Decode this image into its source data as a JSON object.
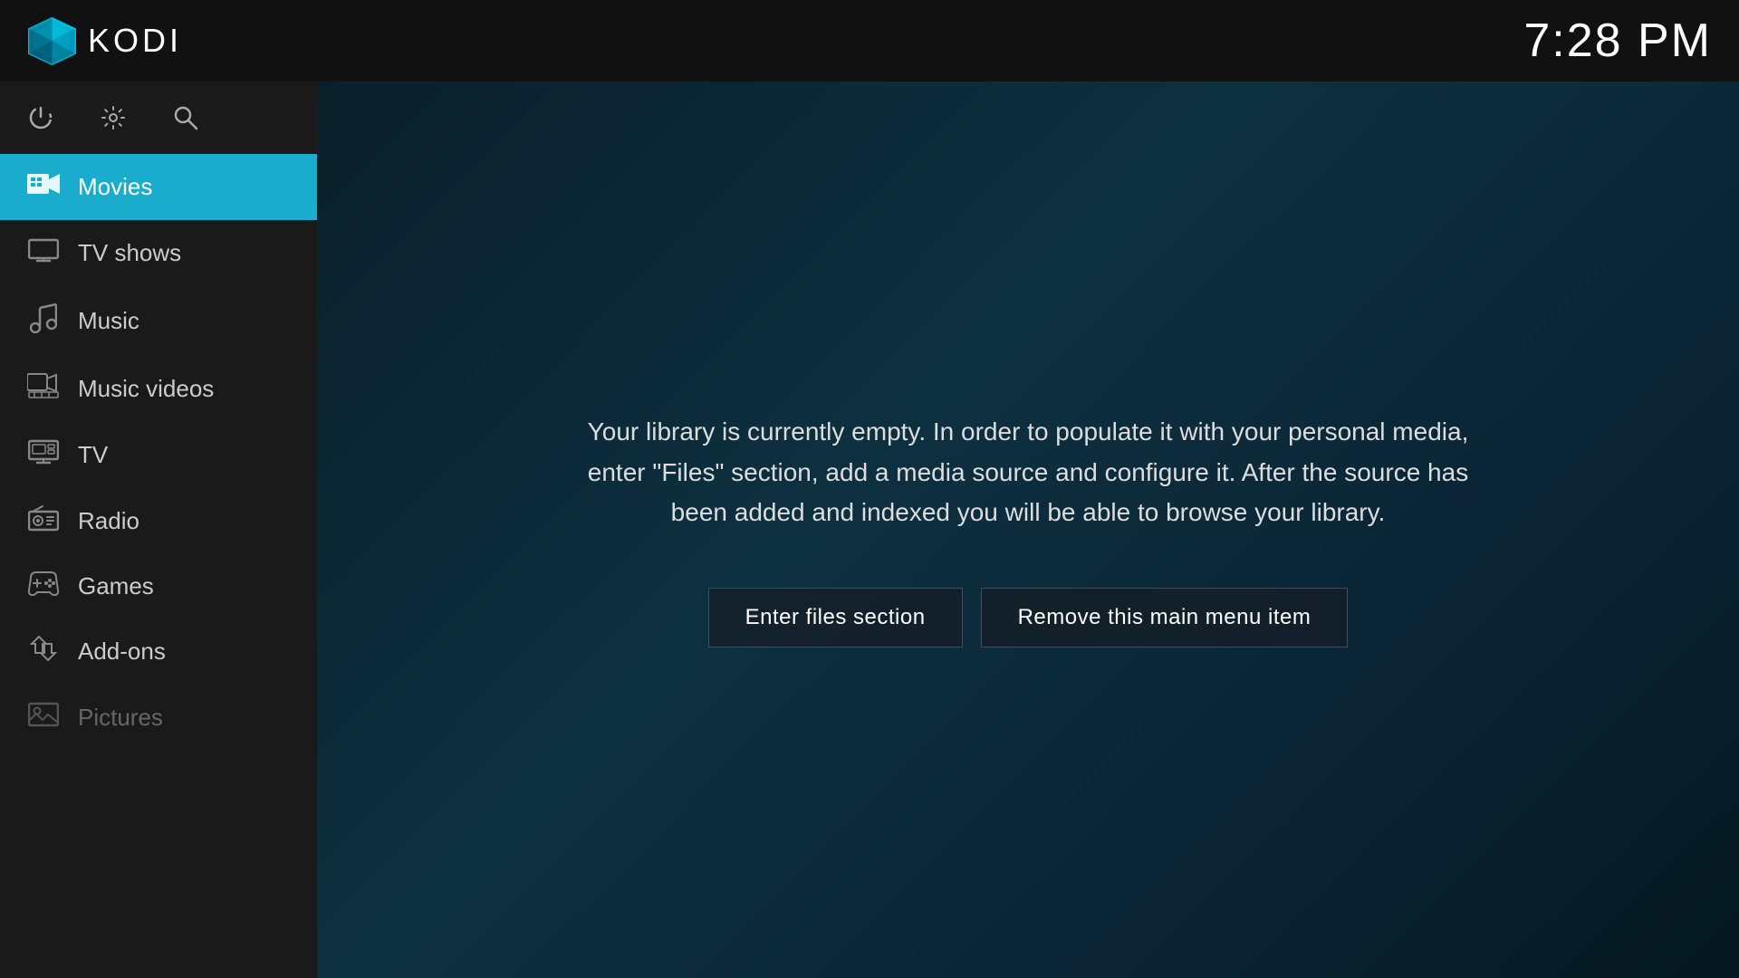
{
  "topbar": {
    "app_name": "KODI",
    "time": "7:28 PM"
  },
  "toolbar": {
    "icons": [
      {
        "name": "power-icon",
        "symbol": "⏻"
      },
      {
        "name": "settings-icon",
        "symbol": "⚙"
      },
      {
        "name": "search-icon",
        "symbol": "🔍"
      }
    ]
  },
  "sidebar": {
    "items": [
      {
        "id": "movies",
        "label": "Movies",
        "icon": "movies-icon",
        "active": true
      },
      {
        "id": "tv-shows",
        "label": "TV shows",
        "icon": "tv-shows-icon",
        "active": false
      },
      {
        "id": "music",
        "label": "Music",
        "icon": "music-icon",
        "active": false
      },
      {
        "id": "music-videos",
        "label": "Music videos",
        "icon": "music-videos-icon",
        "active": false
      },
      {
        "id": "tv",
        "label": "TV",
        "icon": "tv-icon",
        "active": false
      },
      {
        "id": "radio",
        "label": "Radio",
        "icon": "radio-icon",
        "active": false
      },
      {
        "id": "games",
        "label": "Games",
        "icon": "games-icon",
        "active": false
      },
      {
        "id": "add-ons",
        "label": "Add-ons",
        "icon": "addons-icon",
        "active": false
      },
      {
        "id": "pictures",
        "label": "Pictures",
        "icon": "pictures-icon",
        "active": false,
        "dimmed": true
      }
    ]
  },
  "content": {
    "empty_message": "Your library is currently empty. In order to populate it with your personal media, enter \"Files\" section, add a media source and configure it. After the source has been added and indexed you will be able to browse your library.",
    "buttons": [
      {
        "id": "enter-files",
        "label": "Enter files section"
      },
      {
        "id": "remove-menu",
        "label": "Remove this main menu item"
      }
    ]
  }
}
